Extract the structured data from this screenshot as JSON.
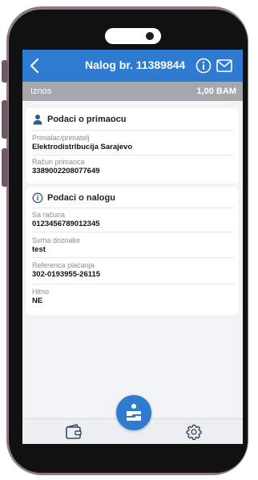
{
  "header": {
    "title": "Nalog br. 11389844",
    "back_icon": "chevron-left-icon",
    "info_icon": "info-icon",
    "mail_icon": "mail-icon"
  },
  "amount": {
    "label": "Iznos",
    "value": "1,00 BAM"
  },
  "recipient_section": {
    "title": "Podaci o primaocu",
    "icon": "person-icon",
    "fields": [
      {
        "label": "Primalac/primatelj",
        "value": "Elektrodistribucija Sarajevo"
      },
      {
        "label": "Račun primaoca",
        "value": "3389002208077649"
      }
    ]
  },
  "order_section": {
    "title": "Podaci o nalogu",
    "icon": "info-icon",
    "fields": [
      {
        "label": "Sa računa",
        "value": "0123456789012345"
      },
      {
        "label": "Svrha doznake",
        "value": "test"
      },
      {
        "label": "Referenca plaćanja",
        "value": "302-0193955-26115"
      },
      {
        "label": "Hitno",
        "value": "NE"
      }
    ]
  },
  "tabbar": {
    "left_icon": "wallet-icon",
    "center_icon": "bank-logo-icon",
    "right_icon": "gear-icon"
  },
  "colors": {
    "accent": "#2e7bd1",
    "amount_bar": "#a5a8ad",
    "background": "#f2f3f5"
  }
}
